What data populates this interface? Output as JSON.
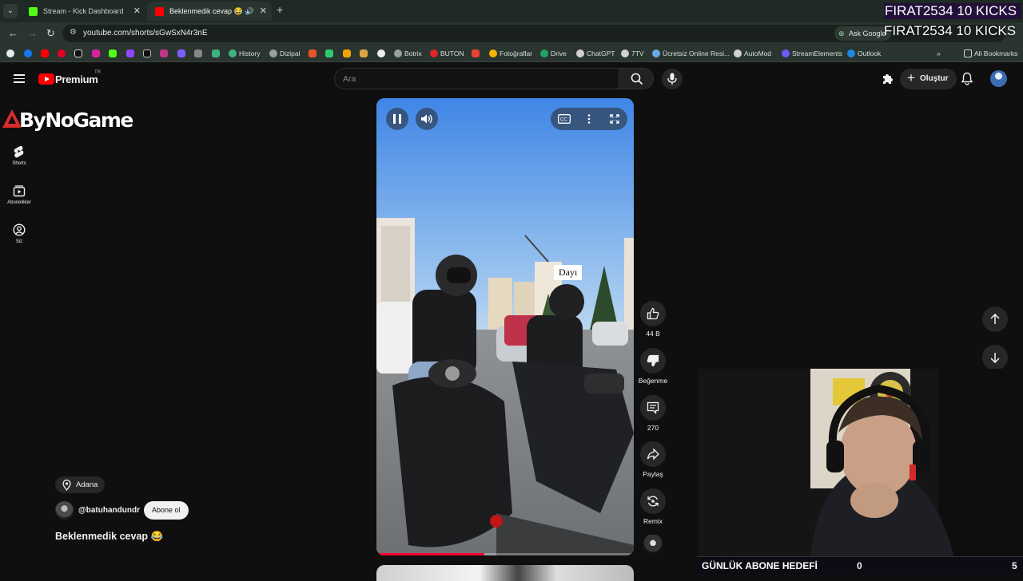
{
  "browser": {
    "tabs": [
      {
        "title": "Stream - Kick Dashboard",
        "favicon_color": "#53fc18",
        "active": false
      },
      {
        "title": "Beklenmedik cevap 😂 - YouTube",
        "favicon_color": "#ff0000",
        "active": true
      }
    ],
    "url": "youtube.com/shorts/sGwSxN4r3nE",
    "ask_google": "Ask Google",
    "bookmarks": [
      {
        "label": "History",
        "color": "#3fb27f"
      },
      {
        "label": "Dizipal",
        "color": "#9aa09c"
      },
      {
        "label": "Botrix",
        "color": "#9aa09c"
      },
      {
        "label": "BUTON",
        "color": "#e02424"
      },
      {
        "label": "Fotoğraflar",
        "color": "#f4b400"
      },
      {
        "label": "Drive",
        "color": "#1fa463"
      },
      {
        "label": "ChatGPT",
        "color": "#d0d0d0"
      },
      {
        "label": "7TV",
        "color": "#d0d0d0"
      },
      {
        "label": "Ücretsiz Online Resi...",
        "color": "#6aa8e8"
      },
      {
        "label": "AutoMod",
        "color": "#d0d0d0"
      },
      {
        "label": "StreamElements",
        "color": "#6b5cff"
      },
      {
        "label": "Outlook",
        "color": "#1e88e5"
      }
    ],
    "all_bookmarks": "All Bookmarks"
  },
  "youtube": {
    "logo_text": "Premium",
    "region": "TR",
    "search_placeholder": "Ara",
    "create_label": "Oluştur",
    "guide": [
      {
        "label": "Shorts"
      },
      {
        "label": "Abonelikler"
      },
      {
        "label": "Siz"
      }
    ]
  },
  "short": {
    "overlay_caption": "Dayı",
    "progress": 0.42,
    "actions": {
      "likes": "44 B",
      "dislike_label": "Beğenme",
      "comments": "270",
      "share_label": "Paylaş",
      "remix_label": "Remix"
    },
    "location": "Adana",
    "channel": "@batuhandundr",
    "subscribe_label": "Abone ol",
    "title": "Beklenmedik cevap 😂"
  },
  "stream_overlay": {
    "brand": "ByNoGame",
    "kicks_line_1": "FIRAT2534  10 KICKS",
    "kicks_line_2": "FIRAT2534  10 KICKS",
    "goal_label": "GÜNLÜK ABONE HEDEFİ",
    "goal_current": "0",
    "goal_max": "5"
  }
}
